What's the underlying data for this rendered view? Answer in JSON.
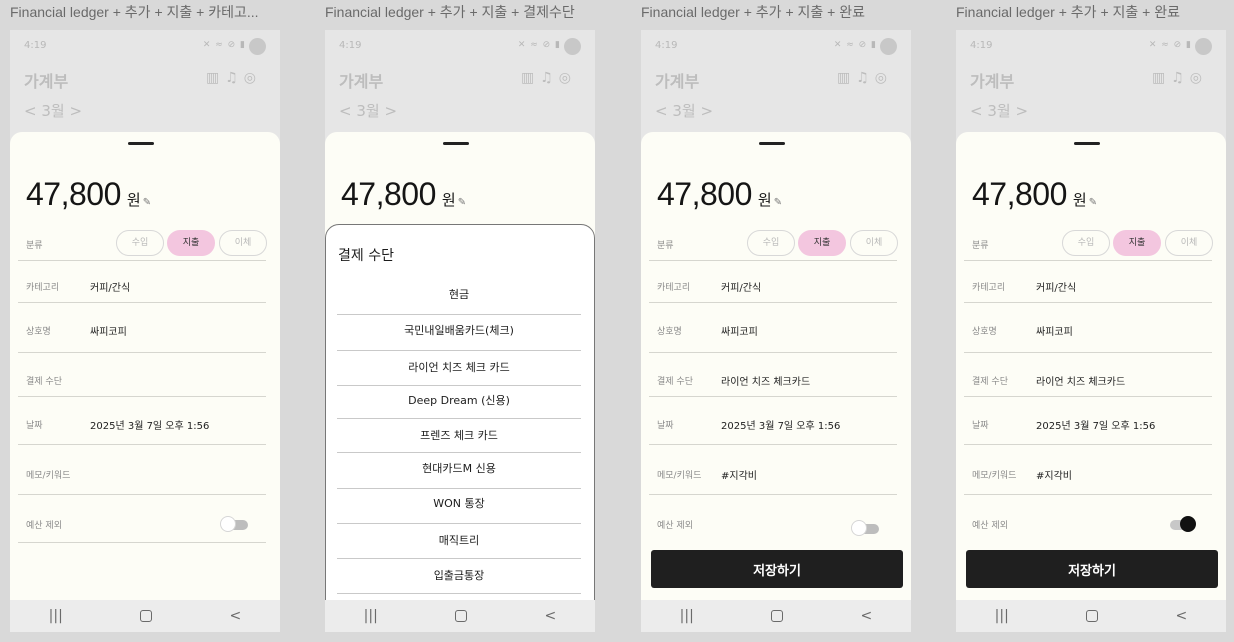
{
  "frames": [
    {
      "label": "Financial ledger + 추가 + 지출 + 카테고..."
    },
    {
      "label": "Financial ledger + 추가 + 지출 + 결제수단"
    },
    {
      "label": "Financial ledger + 추가 + 지출 +  완료"
    },
    {
      "label": "Financial ledger + 추가 + 지출 +  완료"
    }
  ],
  "status": {
    "time": "4:19",
    "icons": "✕ ≈ ⊘ ▮"
  },
  "app": {
    "title": "가계부",
    "month": "3월",
    "prev_icon": "<",
    "next_icon": ">"
  },
  "form": {
    "amount": "47,800",
    "currency": "원",
    "edit_icon": "✎",
    "type_label": "분류",
    "type_income": "수입",
    "type_expense": "지출",
    "type_transfer": "이체",
    "category_label": "카테고리",
    "category_value": "커피/간식",
    "store_label": "상호명",
    "store_value": "싸피코피",
    "payment_label": "결제 수단",
    "payment_value": "라이언 치즈 체크카드",
    "date_label": "날짜",
    "date_value": "2025년 3월 7일 오후 1:56",
    "memo_label": "메모/키워드",
    "memo_value": "#지각비",
    "budget_label": "예산 제외",
    "save_label": "저장하기"
  },
  "picker": {
    "title": "결제 수단",
    "options": [
      "현금",
      "국민내일배움카드(체크)",
      "라이언 치즈 체크 카드",
      "Deep Dream (신용)",
      "프렌즈 체크 카드",
      "현대카드M 신용",
      "WON 통장",
      "매직트리",
      "입출금통장"
    ]
  },
  "navbar": {
    "recent": "|||",
    "back": "<"
  }
}
